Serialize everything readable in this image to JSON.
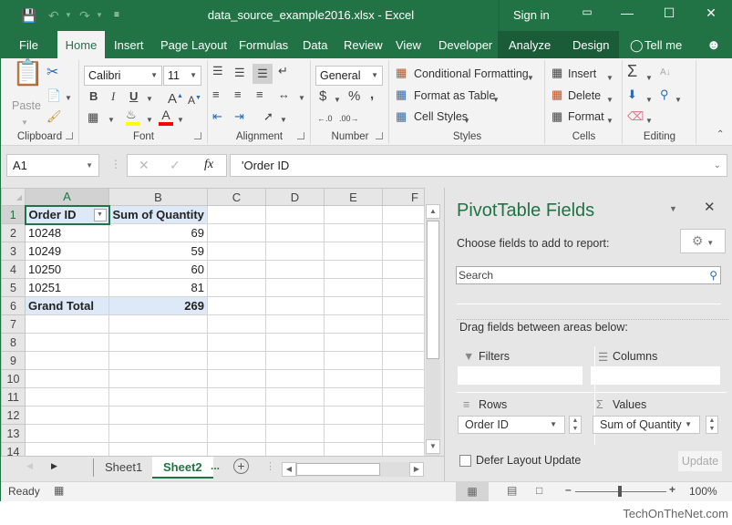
{
  "window": {
    "title": "data_source_example2016.xlsx - Excel",
    "sign_in": "Sign in",
    "icons": [
      "save-icon",
      "undo-icon",
      "redo-icon",
      "customize-qat-icon",
      "ribbon-display-icon",
      "minimize-icon",
      "maximize-icon",
      "close-icon"
    ]
  },
  "tabs": [
    {
      "label": "File",
      "active": false
    },
    {
      "label": "Home",
      "active": true
    },
    {
      "label": "Insert",
      "active": false
    },
    {
      "label": "Page Layout",
      "active": false
    },
    {
      "label": "Formulas",
      "active": false
    },
    {
      "label": "Data",
      "active": false
    },
    {
      "label": "Review",
      "active": false
    },
    {
      "label": "View",
      "active": false
    },
    {
      "label": "Developer",
      "active": false
    },
    {
      "label": "Analyze",
      "active": false
    },
    {
      "label": "Design",
      "active": false
    }
  ],
  "tell_me": "Tell me",
  "ribbon": {
    "clipboard": {
      "label": "Clipboard",
      "paste": "Paste"
    },
    "font": {
      "label": "Font",
      "name": "Calibri",
      "size": "11",
      "bold": "B",
      "italic": "I",
      "underline": "U",
      "highlight_color": "#ffff00",
      "font_color": "#ff0000"
    },
    "alignment": {
      "label": "Alignment"
    },
    "number": {
      "label": "Number",
      "format": "General",
      "currency": "$",
      "percent": "%",
      "comma": ","
    },
    "styles": {
      "label": "Styles",
      "conditional": "Conditional Formatting",
      "format_table": "Format as Table",
      "cell_styles": "Cell Styles"
    },
    "cells": {
      "label": "Cells",
      "insert": "Insert",
      "delete": "Delete",
      "format": "Format"
    },
    "editing": {
      "label": "Editing"
    }
  },
  "formula_bar": {
    "name_box": "A1",
    "formula": "'Order ID",
    "fx": "fx"
  },
  "grid": {
    "columns": [
      "A",
      "B",
      "C",
      "D",
      "E",
      "F"
    ],
    "rows": [
      "1",
      "2",
      "3",
      "4",
      "5",
      "6",
      "7",
      "8",
      "9",
      "10",
      "11",
      "12",
      "13",
      "14"
    ],
    "cells": [
      [
        "Order ID",
        "Sum of Quantity"
      ],
      [
        "10248",
        "69"
      ],
      [
        "10249",
        "59"
      ],
      [
        "10250",
        "60"
      ],
      [
        "10251",
        "81"
      ],
      [
        "Grand Total",
        "269"
      ]
    ]
  },
  "sheets": {
    "tabs": [
      "Sheet1",
      "Sheet2"
    ],
    "active": "Sheet2",
    "more": "..."
  },
  "status": {
    "ready": "Ready",
    "zoom": "100%"
  },
  "pivot_pane": {
    "title": "PivotTable Fields",
    "choose": "Choose fields to add to report:",
    "search_placeholder": "Search",
    "drag": "Drag fields between areas below:",
    "filters": "Filters",
    "columns": "Columns",
    "rows": "Rows",
    "values": "Values",
    "rows_field": "Order ID",
    "values_field": "Sum of Quantity",
    "defer": "Defer Layout Update",
    "update": "Update"
  },
  "watermark": "TechOnTheNet.com",
  "colors": {
    "accent": "#217346",
    "pivot_header": "#dde9f6"
  }
}
